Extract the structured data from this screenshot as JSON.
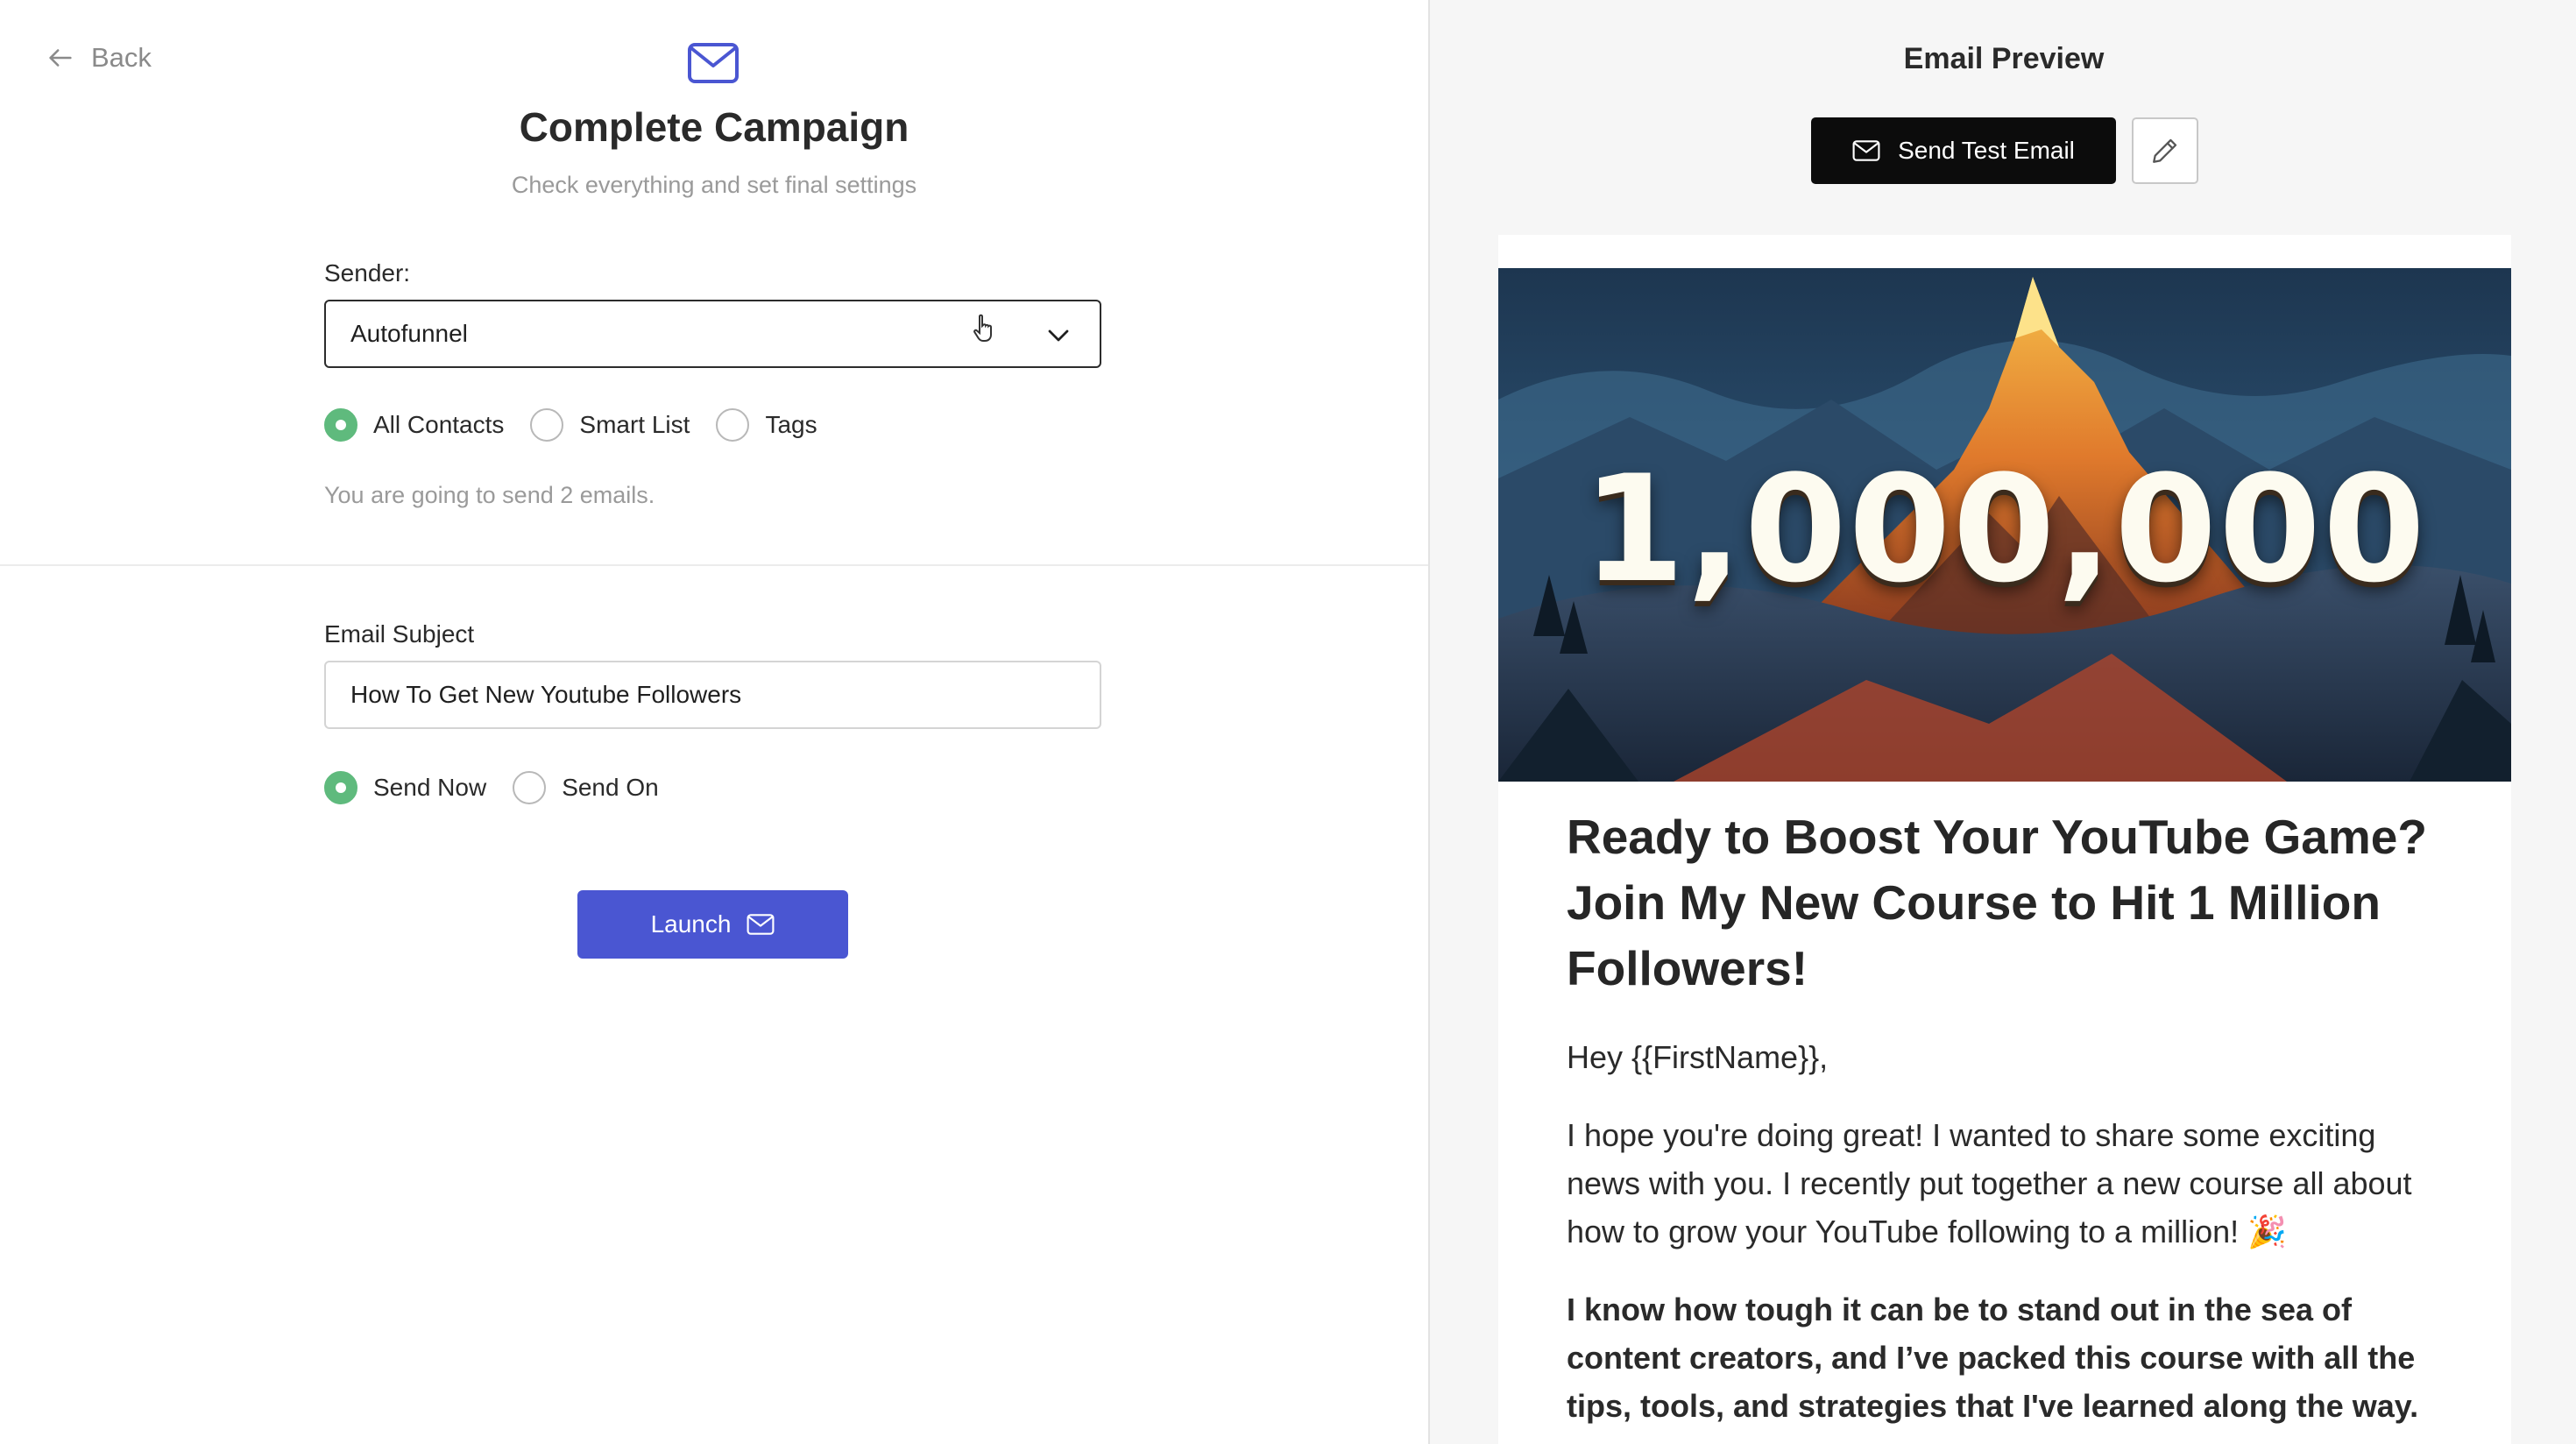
{
  "nav": {
    "back_label": "Back"
  },
  "header": {
    "title": "Complete Campaign",
    "subtitle": "Check everything and set final settings"
  },
  "sender": {
    "label": "Sender:",
    "selected": "Autofunnel"
  },
  "audience": {
    "options": [
      {
        "label": "All Contacts",
        "selected": true
      },
      {
        "label": "Smart List",
        "selected": false
      },
      {
        "label": "Tags",
        "selected": false
      }
    ],
    "helper": "You are going to send 2 emails."
  },
  "subject": {
    "label": "Email Subject",
    "value": "How To Get New Youtube Followers"
  },
  "schedule": {
    "options": [
      {
        "label": "Send Now",
        "selected": true
      },
      {
        "label": "Send On",
        "selected": false
      }
    ]
  },
  "launch_label": "Launch",
  "preview": {
    "title": "Email Preview",
    "send_test_label": "Send Test Email",
    "hero_text": "1,000,000",
    "heading": "Ready to Boost Your YouTube Game? Join My New Course to Hit 1 Million Followers!",
    "greeting": "Hey {{FirstName}},",
    "paragraph1": "I hope you're doing great! I wanted to share some exciting news with you. I recently put together a new course all about how to grow your YouTube following to a million! 🎉",
    "paragraph2": "I know how tough it can be to stand out in the sea of content creators, and I’ve packed this course with all the tips, tools, and strategies that I've learned along the way."
  },
  "colors": {
    "accent": "#4a56d2",
    "radio_selected": "#5fba7d",
    "send_test_bg": "#0c0c0c"
  },
  "icons": {
    "back": "arrow-left-icon",
    "header": "envelope-icon",
    "dropdown": "chevron-down-icon",
    "launch": "envelope-icon",
    "send_test": "envelope-icon",
    "edit": "pencil-icon"
  }
}
